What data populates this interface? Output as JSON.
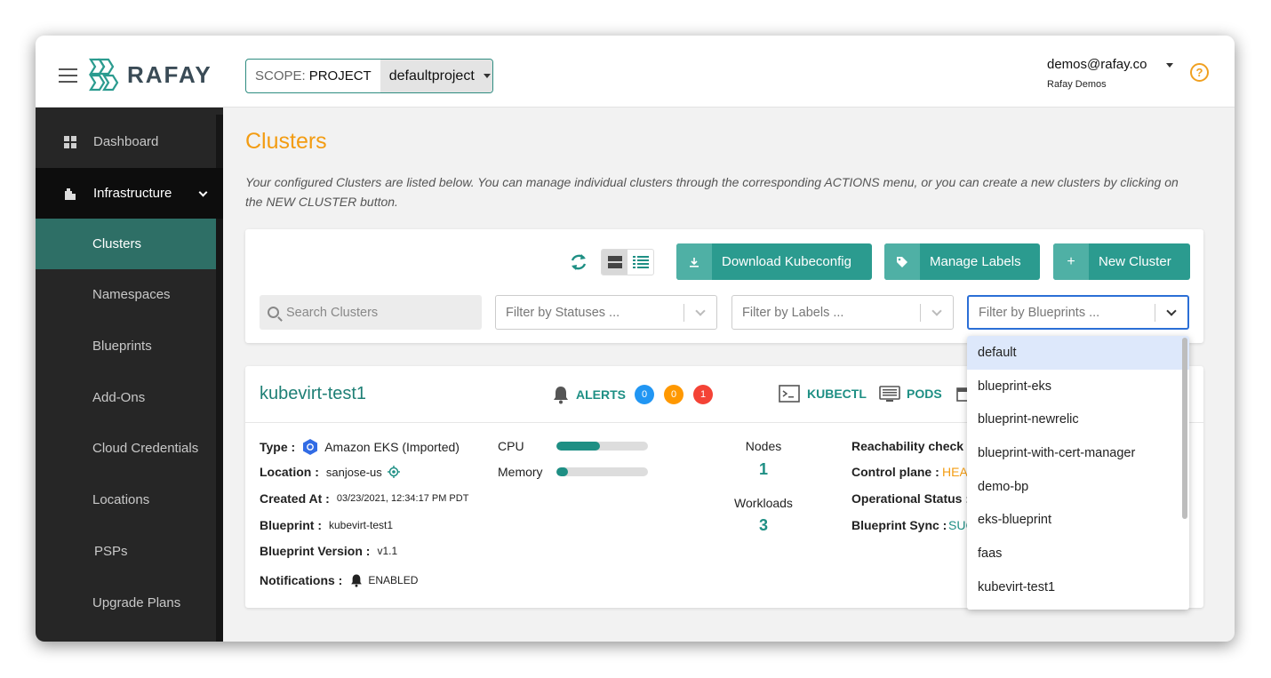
{
  "header": {
    "brand": "RAFAY",
    "scope": {
      "prefix": "SCOPE:",
      "level": "PROJECT",
      "project": "defaultproject"
    },
    "user": {
      "email": "demos@rafay.co",
      "org": "Rafay Demos"
    },
    "help_icon": "?"
  },
  "sidebar": {
    "items": [
      {
        "label": "Dashboard",
        "icon": "dashboard-icon"
      },
      {
        "label": "Infrastructure",
        "icon": "building-icon"
      },
      {
        "label": "Clusters"
      },
      {
        "label": "Namespaces"
      },
      {
        "label": "Blueprints"
      },
      {
        "label": "Add-Ons"
      },
      {
        "label": "Cloud Credentials"
      },
      {
        "label": "Locations"
      },
      {
        "label": "PSPs"
      },
      {
        "label": "Upgrade Plans"
      }
    ]
  },
  "main": {
    "title": "Clusters",
    "description": "Your configured Clusters are listed below. You can manage individual clusters through the corresponding ACTIONS menu, or you can create a new clusters by clicking on the NEW CLUSTER button.",
    "toolbar": {
      "download_label": "Download Kubeconfig",
      "labels_label": "Manage Labels",
      "new_label": "New Cluster",
      "search_placeholder": "Search Clusters",
      "filter_status_placeholder": "Filter by Statuses ...",
      "filter_labels_placeholder": "Filter by Labels ...",
      "filter_blueprints_placeholder": "Filter by Blueprints ..."
    },
    "cluster": {
      "name": "kubevirt-test1",
      "alerts_label": "ALERTS",
      "alert_counts": {
        "info": "0",
        "warning": "0",
        "critical": "1"
      },
      "kubectl_label": "KUBECTL",
      "pods_label": "PODS",
      "type_key": "Type :",
      "type_value": "Amazon EKS (Imported)",
      "location_key": "Location :",
      "location_value": "sanjose-us",
      "created_key": "Created At :",
      "created_value": "03/23/2021, 12:34:17 PM PDT",
      "blueprint_key": "Blueprint :",
      "blueprint_value": "kubevirt-test1",
      "bpversion_key": "Blueprint Version :",
      "bpversion_value": "v1.1",
      "notifications_key": "Notifications :",
      "notifications_value": "ENABLED",
      "cpu_label": "CPU",
      "cpu_usage": 0.48,
      "memory_label": "Memory",
      "memory_usage": 0.13,
      "nodes_label": "Nodes",
      "nodes_value": "1",
      "workloads_label": "Workloads",
      "workloads_value": "3",
      "reachability_key": "Reachability check :",
      "control_plane_key": "Control plane :",
      "control_plane_value": "HEA",
      "operational_key": "Operational Status :",
      "bp_sync_key": "Blueprint Sync :",
      "bp_sync_value": "SUC"
    },
    "blueprint_options": [
      "default",
      "blueprint-eks",
      "blueprint-newrelic",
      "blueprint-with-cert-manager",
      "demo-bp",
      "eks-blueprint",
      "faas",
      "kubevirt-test1"
    ]
  },
  "colors": {
    "accent": "#2b9b8f",
    "title": "#f39c12",
    "sidebar_bg": "#262626",
    "active_nav": "#2e6f66",
    "badge_info": "#2196f3",
    "badge_warning": "#ff9800",
    "badge_critical": "#f44336"
  }
}
